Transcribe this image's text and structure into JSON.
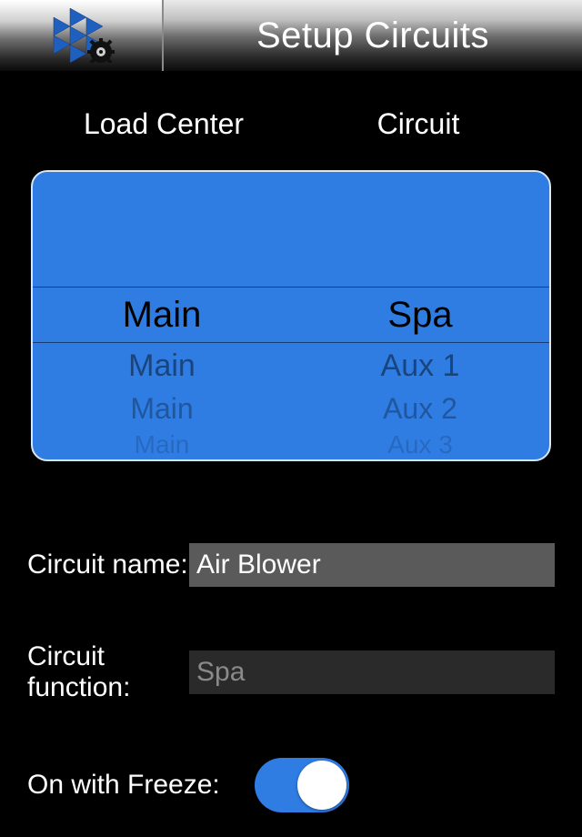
{
  "header": {
    "title": "Setup Circuits"
  },
  "columns": {
    "left_label": "Load Center",
    "right_label": "Circuit"
  },
  "picker": {
    "rows": [
      {
        "left": "Main",
        "right": "Spa"
      },
      {
        "left": "Main",
        "right": "Aux 1"
      },
      {
        "left": "Main",
        "right": "Aux 2"
      },
      {
        "left": "Main",
        "right": "Aux 3"
      }
    ],
    "selected_index": 0
  },
  "form": {
    "circuit_name": {
      "label": "Circuit name:",
      "value": "Air Blower"
    },
    "circuit_function": {
      "label": "Circuit function:",
      "value": "Spa"
    },
    "on_with_freeze": {
      "label": "On with Freeze:",
      "value": true
    }
  }
}
